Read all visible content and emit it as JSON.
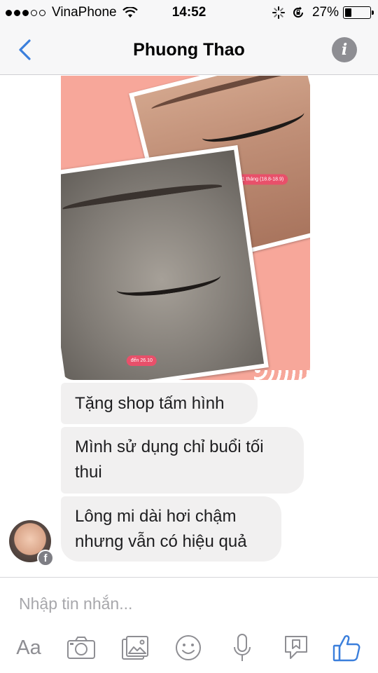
{
  "status_bar": {
    "carrier": "VinaPhone",
    "time": "14:52",
    "battery_percent": "27%",
    "battery_level": 0.27,
    "signal_strength": 3,
    "signal_max": 5
  },
  "nav": {
    "title": "Phuong Thao",
    "back_icon": "chevron-left-icon",
    "info_icon": "info-icon",
    "accent_color": "#3b7fdc"
  },
  "conversation": {
    "photo": {
      "labels": [
        "Sau 1 tháng (18.8-18.9)",
        "đến 26.10"
      ]
    },
    "messages": [
      {
        "text_lines": [
          "Tặng shop tấm hình"
        ]
      },
      {
        "text_lines": [
          "Mình sử dụng chỉ buổi tối",
          "thui"
        ]
      },
      {
        "text_lines": [
          "Lông mi dài hơi chậm",
          "nhưng vẫn có hiệu quả"
        ]
      }
    ]
  },
  "composer": {
    "placeholder": "Nhập tin nhắn...",
    "text_button_label": "Aa",
    "icons": [
      "camera-icon",
      "gallery-icon",
      "emoji-icon",
      "microphone-icon",
      "sticker-icon",
      "like-icon"
    ]
  }
}
